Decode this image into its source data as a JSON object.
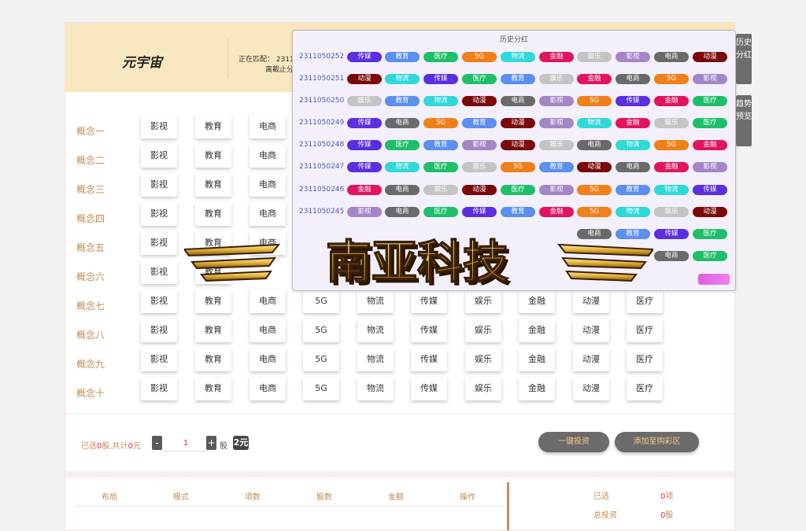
{
  "brand": "元宇宙",
  "match": {
    "line1": "正在匹配： 23110",
    "line2": "离截止分"
  },
  "concepts": [
    {
      "label": "概念一",
      "items": [
        "影视",
        "教育",
        "电商"
      ]
    },
    {
      "label": "概念二",
      "items": [
        "影视",
        "教育",
        "电商"
      ]
    },
    {
      "label": "概念三",
      "items": [
        "影视",
        "教育",
        "电商"
      ]
    },
    {
      "label": "概念四",
      "items": [
        "影视",
        "教育",
        "电商"
      ]
    },
    {
      "label": "概念五",
      "items": [
        "影视",
        "教育",
        "电商"
      ]
    },
    {
      "label": "概念六",
      "items": [
        "影视",
        "教育"
      ]
    },
    {
      "label": "概念七",
      "items": [
        "影视",
        "教育",
        "电商",
        "5G",
        "物流",
        "传媒",
        "娱乐",
        "金融",
        "动漫",
        "医疗"
      ]
    },
    {
      "label": "概念八",
      "items": [
        "影视",
        "教育",
        "电商",
        "5G",
        "物流",
        "传媒",
        "娱乐",
        "金融",
        "动漫",
        "医疗"
      ]
    },
    {
      "label": "概念九",
      "items": [
        "影视",
        "教育",
        "电商",
        "5G",
        "物流",
        "传媒",
        "娱乐",
        "金融",
        "动漫",
        "医疗"
      ]
    },
    {
      "label": "概念十",
      "items": [
        "影视",
        "教育",
        "电商",
        "5G",
        "物流",
        "传媒",
        "娱乐",
        "金融",
        "动漫",
        "医疗"
      ]
    }
  ],
  "selection": {
    "prefix": "已选",
    "count": "0",
    "mid": "股,共计",
    "amount": "0",
    "suffix": "元"
  },
  "quantity": {
    "minus": "-",
    "value": "1",
    "plus": "+",
    "unit": "股",
    "badge": "2元"
  },
  "buttons": {
    "invest": "一键投资",
    "add_cart": "添加至购彩区"
  },
  "table": {
    "headers": [
      "布局",
      "模式",
      "项数",
      "股数",
      "金额",
      "操作"
    ]
  },
  "summary": {
    "selected_label": "已选",
    "selected_value": "0",
    "selected_unit": "项",
    "total_label": "总投资",
    "total_value": "0",
    "total_unit": "股"
  },
  "history": {
    "title": "历史分红",
    "rows": [
      {
        "id": "2311050252",
        "tags": [
          "传媒",
          "教育",
          "医疗",
          "5G",
          "物流",
          "金融",
          "娱乐",
          "影视",
          "电商",
          "动漫"
        ]
      },
      {
        "id": "2311050251",
        "tags": [
          "动漫",
          "物流",
          "传媒",
          "医疗",
          "教育",
          "娱乐",
          "金融",
          "电商",
          "5G",
          "影视"
        ]
      },
      {
        "id": "2311050250",
        "tags": [
          "娱乐",
          "教育",
          "物流",
          "动漫",
          "电商",
          "影视",
          "5G",
          "传媒",
          "金融",
          "医疗"
        ]
      },
      {
        "id": "2311050249",
        "tags": [
          "传媒",
          "电商",
          "5G",
          "教育",
          "动漫",
          "影视",
          "物流",
          "金融",
          "娱乐",
          "医疗"
        ]
      },
      {
        "id": "2311050248",
        "tags": [
          "传媒",
          "医疗",
          "教育",
          "影视",
          "动漫",
          "娱乐",
          "电商",
          "物流",
          "5G",
          "金融"
        ]
      },
      {
        "id": "2311050247",
        "tags": [
          "传媒",
          "物流",
          "医疗",
          "娱乐",
          "5G",
          "教育",
          "动漫",
          "电商",
          "金融",
          "影视"
        ]
      },
      {
        "id": "2311050246",
        "tags": [
          "金融",
          "电商",
          "娱乐",
          "动漫",
          "医疗",
          "影视",
          "5G",
          "教育",
          "物流",
          "传媒"
        ]
      },
      {
        "id": "2311050245",
        "tags": [
          "影视",
          "电商",
          "医疗",
          "传媒",
          "教育",
          "金融",
          "5G",
          "物流",
          "娱乐",
          "动漫"
        ]
      },
      {
        "id": "",
        "tags": [
          "",
          "",
          "",
          "",
          "",
          "",
          "电商",
          "教育",
          "传媒",
          "医疗"
        ]
      },
      {
        "id": "",
        "tags": [
          "",
          "",
          "",
          "",
          "",
          "",
          "",
          "",
          "电商",
          "医疗"
        ]
      }
    ]
  },
  "tag_colors": {
    "传媒": "#5b2ee0",
    "教育": "#5b8ff0",
    "医疗": "#1fbf6a",
    "5G": "#f08018",
    "物流": "#30d8d8",
    "金融": "#e2145f",
    "娱乐": "#c4c4c4",
    "影视": "#a486c8",
    "电商": "#6a6a6a",
    "动漫": "#7a0a0a"
  },
  "side_tabs": [
    "历史分红",
    "趋势预览"
  ],
  "logo_text": "南亚科技"
}
